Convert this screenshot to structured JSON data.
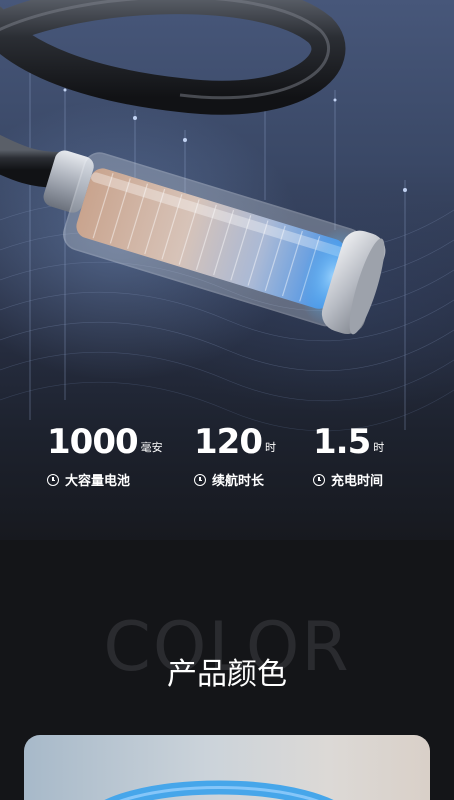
{
  "stats": [
    {
      "value": "1000",
      "unit": "毫安",
      "label": "大容量电池"
    },
    {
      "value": "120",
      "unit": "时",
      "label": "续航时长"
    },
    {
      "value": "1.5",
      "unit": "时",
      "label": "充电时间"
    }
  ],
  "color_section": {
    "bg_word": "COLOR",
    "title": "产品颜色"
  },
  "colors": {
    "background": "#141518",
    "accent_blue": "#3fa7ee",
    "text": "#ffffff"
  }
}
